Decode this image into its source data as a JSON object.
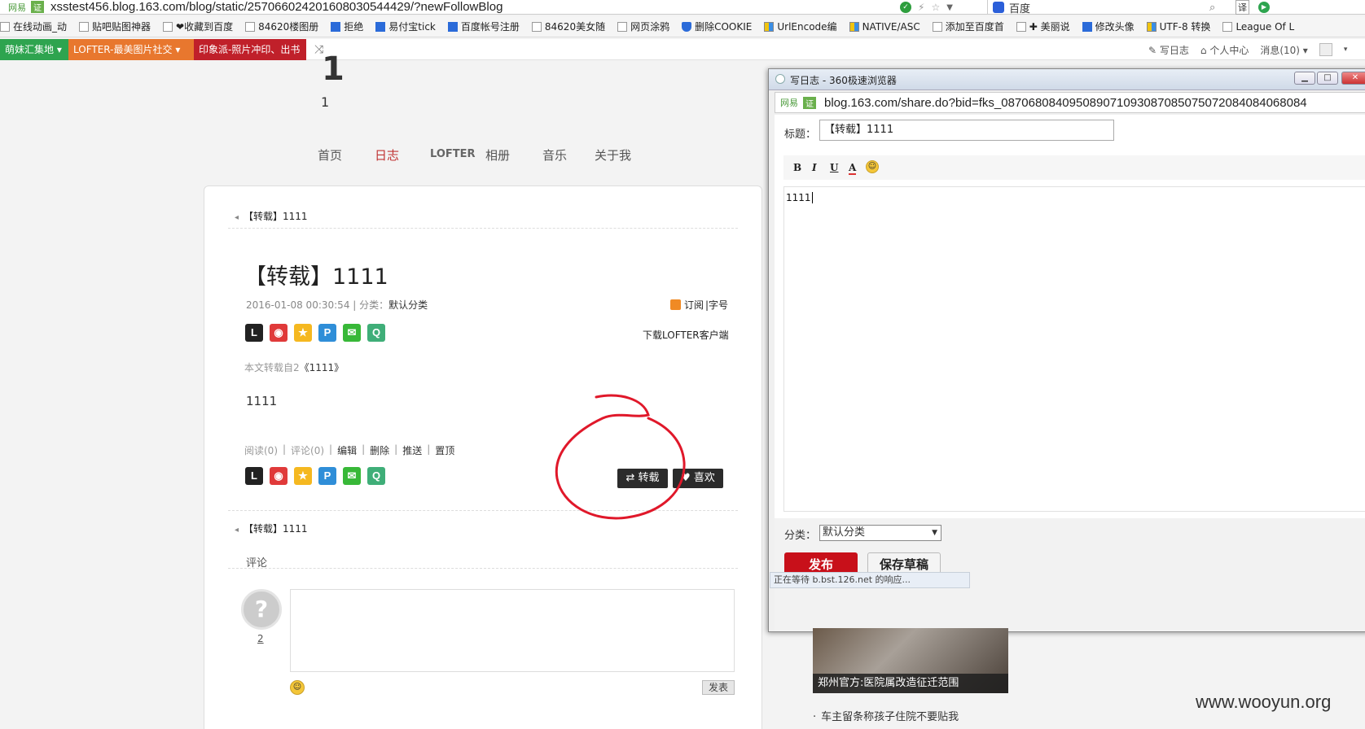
{
  "browser": {
    "tag": "网易",
    "cert": "证",
    "url": "xsstest456.blog.163.com/blog/static/257066024201608030544429/?newFollowBlog",
    "search_engine": "百度",
    "translate_label": "译"
  },
  "bookmarks": [
    {
      "label": "在线动画_动",
      "icon": "page-icon"
    },
    {
      "label": "贴吧贴图神器",
      "icon": "page-icon"
    },
    {
      "label": "❤收藏到百度",
      "icon": "page-icon"
    },
    {
      "label": "84620楼图册",
      "icon": "page-icon"
    },
    {
      "label": "拒绝",
      "icon": "blue-icon"
    },
    {
      "label": "易付宝tick",
      "icon": "blue-icon"
    },
    {
      "label": "百度帐号注册",
      "icon": "baidu-icon"
    },
    {
      "label": "84620美女随",
      "icon": "page-icon"
    },
    {
      "label": "网页涂鸦",
      "icon": "page-icon"
    },
    {
      "label": "删除COOKIE",
      "icon": "shield-icon"
    },
    {
      "label": "UrlEncode编",
      "icon": "ms-icon"
    },
    {
      "label": "NATIVE/ASC",
      "icon": "ms-icon"
    },
    {
      "label": "添加至百度首",
      "icon": "page-icon"
    },
    {
      "label": "✚ 美丽说",
      "icon": "page-icon"
    },
    {
      "label": "修改头像",
      "icon": "baidu-icon"
    },
    {
      "label": "UTF-8 转换",
      "icon": "ms-icon"
    },
    {
      "label": "League Of L",
      "icon": "page-icon"
    }
  ],
  "toolbar": {
    "chips": [
      "萌妹汇集地",
      "LOFTER-最美图片社交",
      "印象派-照片冲印、出书"
    ],
    "write_log": "写日志",
    "personal_center": "个人中心",
    "messages": "消息(10)"
  },
  "blog": {
    "big_number": "1",
    "number": "1",
    "nav": [
      "首页",
      "日志",
      "LOFTER",
      "相册",
      "音乐",
      "关于我"
    ],
    "crumb": "【转载】1111",
    "title": "【转载】1111",
    "meta_date": "2016-01-08 00:30:54",
    "meta_sep": " | 分类：",
    "meta_category": "默认分类",
    "subscribe": "订阅",
    "font_size": "|字号",
    "download_lofter": "下载LOFTER客户端",
    "reprint_prefix": "本文转载自2",
    "reprint_title": "《1111》",
    "body": "1111",
    "stats": {
      "read": "阅读(0)",
      "comment": "评论(0)",
      "edit": "编辑",
      "delete": "删除",
      "push": "推送",
      "top": "置顶"
    },
    "reprint_button": "转载",
    "like_button": "喜欢",
    "crumb2": "【转载】1111",
    "comments_heading": "评论",
    "avatar_num": "2",
    "send_button": "发表"
  },
  "popup": {
    "window_title": "写日志 - 360极速浏览器",
    "tag": "网易",
    "cert": "证",
    "url": "blog.163.com/share.do?bid=fks_087068084095089071093087085075072084084068084",
    "title_label": "标题：",
    "title_value": "【转载】1111",
    "format_buttons": [
      "B",
      "I",
      "U",
      "A"
    ],
    "editor_text": "1111",
    "category_label": "分类：",
    "category_value": "默认分类",
    "publish": "发布",
    "save_draft": "保存草稿",
    "status": "正在等待 b.bst.126.net 的响应..."
  },
  "ad": {
    "caption": "郑州官方:医院属改造征迁范围",
    "list_item": "车主留条称孩子住院不要贴我"
  },
  "watermark": "www.wooyun.org",
  "colors": {
    "accent_red": "#c03333",
    "publish_red": "#c8101a",
    "annotation_red": "#e0182a"
  }
}
